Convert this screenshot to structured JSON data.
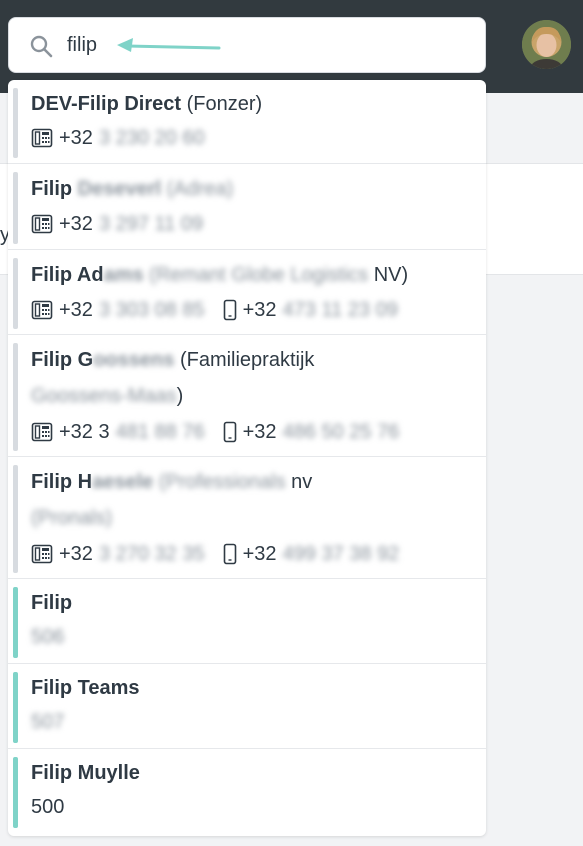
{
  "topbar": {
    "bg_color": "#323a3f"
  },
  "search": {
    "icon": "search-icon",
    "value": "filip",
    "arrow_color": "#7fd3c8"
  },
  "avatar": {
    "icon": "user-avatar"
  },
  "background": {
    "stray_text": "y"
  },
  "results": [
    {
      "name": "DEV-Filip Direct",
      "name_blur": "",
      "org": "(Fonzer)",
      "org_blur": "",
      "org_tail": "",
      "landline_prefix": "+32",
      "landline_blur": "3 230 20 60",
      "mobile_prefix": "",
      "mobile_blur": "",
      "bar_color": "#d7dbe0"
    },
    {
      "name": "Filip",
      "name_blur": "Deseverl",
      "org": "",
      "org_blur": "(Adrea)",
      "org_tail": "",
      "landline_prefix": "+32",
      "landline_blur": "3 297 11 09",
      "mobile_prefix": "",
      "mobile_blur": "",
      "bar_color": "#d7dbe0"
    },
    {
      "name": "Filip Ad",
      "name_blur": "ams",
      "org": "",
      "org_blur": "(Remant Globe Logistics",
      "org_tail": "NV)",
      "landline_prefix": "+32",
      "landline_blur": "3 303 08 85",
      "mobile_prefix": "+32",
      "mobile_blur": "473 11 23 09",
      "bar_color": "#d7dbe0"
    },
    {
      "name": "Filip G",
      "name_blur": "oossens",
      "org": "(Familiepraktijk",
      "org_line2_blur": "Goossens-Maas",
      "org_line2_tail": ")",
      "landline_prefix": "+32 3",
      "landline_blur": "481 88 76",
      "mobile_prefix": "+32",
      "mobile_blur": "486 50 25 76",
      "bar_color": "#d7dbe0"
    },
    {
      "name": "Filip H",
      "name_blur": "aesele",
      "org": "",
      "org_blur": "(Professionals",
      "org_tail": "nv",
      "org_line2_blur": "(Pronals)",
      "org_line2_tail": "",
      "landline_prefix": "+32",
      "landline_blur": "3 270 32 35",
      "mobile_prefix": "+32",
      "mobile_blur": "499 37 38 92",
      "bar_color": "#d7dbe0"
    },
    {
      "name": "Filip",
      "sub_blur": "506",
      "bar_color": "#7fd3c8"
    },
    {
      "name": "Filip Teams",
      "sub_blur": "507",
      "bar_color": "#7fd3c8"
    },
    {
      "name": "Filip Muylle",
      "sub": "500",
      "bar_color": "#7fd3c8"
    }
  ]
}
